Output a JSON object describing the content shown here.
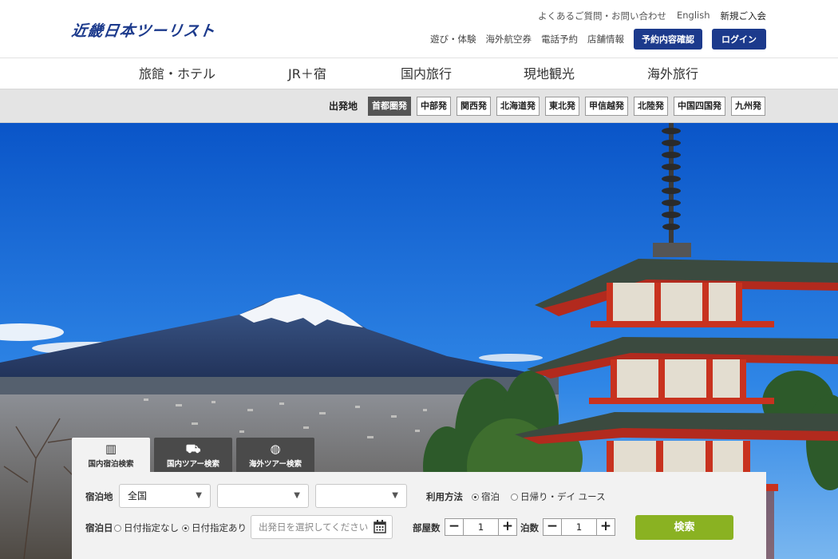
{
  "header": {
    "logo_text": "近畿日本ツーリスト",
    "util_links": [
      "よくあるご質問・お問い合わせ",
      "English",
      "新規ご入会"
    ],
    "sub_links": [
      "遊び・体験",
      "海外航空券",
      "電話予約",
      "店舗情報"
    ],
    "reservation_button": "予約内容確認",
    "login_button": "ログイン"
  },
  "nav": {
    "items": [
      "旅館・ホテル",
      "JR＋宿",
      "国内旅行",
      "現地観光",
      "海外旅行"
    ]
  },
  "departure": {
    "label": "出発地",
    "items": [
      "首都圏発",
      "中部発",
      "関西発",
      "北海道発",
      "東北発",
      "甲信越発",
      "北陸発",
      "中国四国発",
      "九州発"
    ]
  },
  "search": {
    "tabs": [
      {
        "label": "国内宿泊検索",
        "icon": "building-icon"
      },
      {
        "label": "国内ツアー検索",
        "icon": "train-icon"
      },
      {
        "label": "海外ツアー検索",
        "icon": "globe-icon"
      }
    ],
    "destination_label": "宿泊地",
    "destination_value": "全国",
    "usage_label": "利用方法",
    "usage_options": [
      "宿泊",
      "日帰り・デイ ユース"
    ],
    "date_label": "宿泊日",
    "date_options": [
      "日付指定なし",
      "日付指定あり"
    ],
    "date_placeholder": "出発日を選択してください",
    "rooms_label": "部屋数",
    "rooms_value": "1",
    "nights_label": "泊数",
    "nights_value": "1",
    "search_button": "検索"
  },
  "colors": {
    "brand_navy": "#1c3a8c",
    "search_green": "#8ab222",
    "active_departure": "#555555"
  }
}
